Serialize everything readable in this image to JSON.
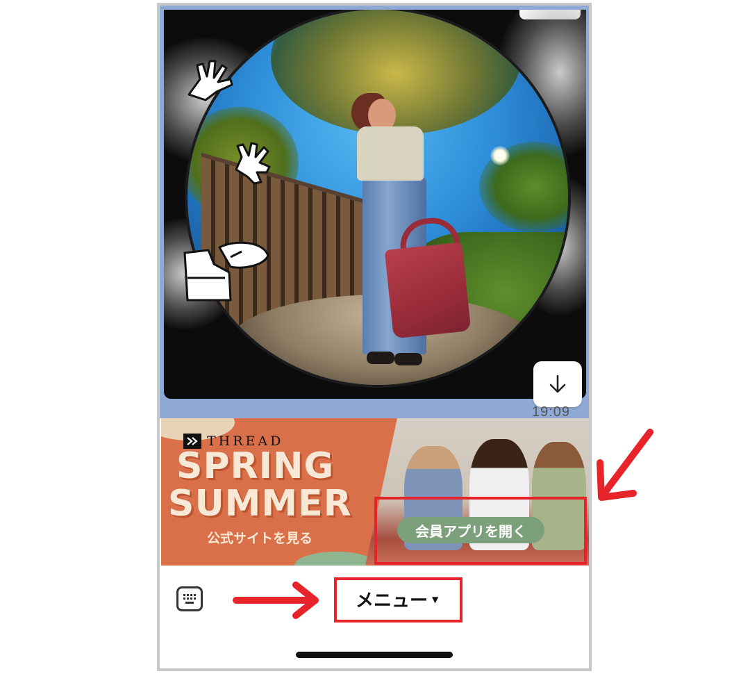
{
  "chat": {
    "timestamp": "19:09"
  },
  "banner": {
    "brand": "THREAD",
    "headline_line1": "SPRING",
    "headline_line2": "SUMMER",
    "site_link": "公式サイトを見る",
    "app_button": "会員アプリを開く"
  },
  "bottom_bar": {
    "menu_label": "メニュー",
    "menu_caret": "▼"
  },
  "icons": {
    "download": "download-arrow-icon",
    "keyboard": "keyboard-icon",
    "brand_logo": "thread-logo-icon"
  },
  "colors": {
    "chat_background": "#8fa9d6",
    "banner_orange": "#d9704a",
    "banner_cream": "#f7e9d6",
    "app_button_green": "#7da07c",
    "annotation_red": "#e8242b"
  }
}
